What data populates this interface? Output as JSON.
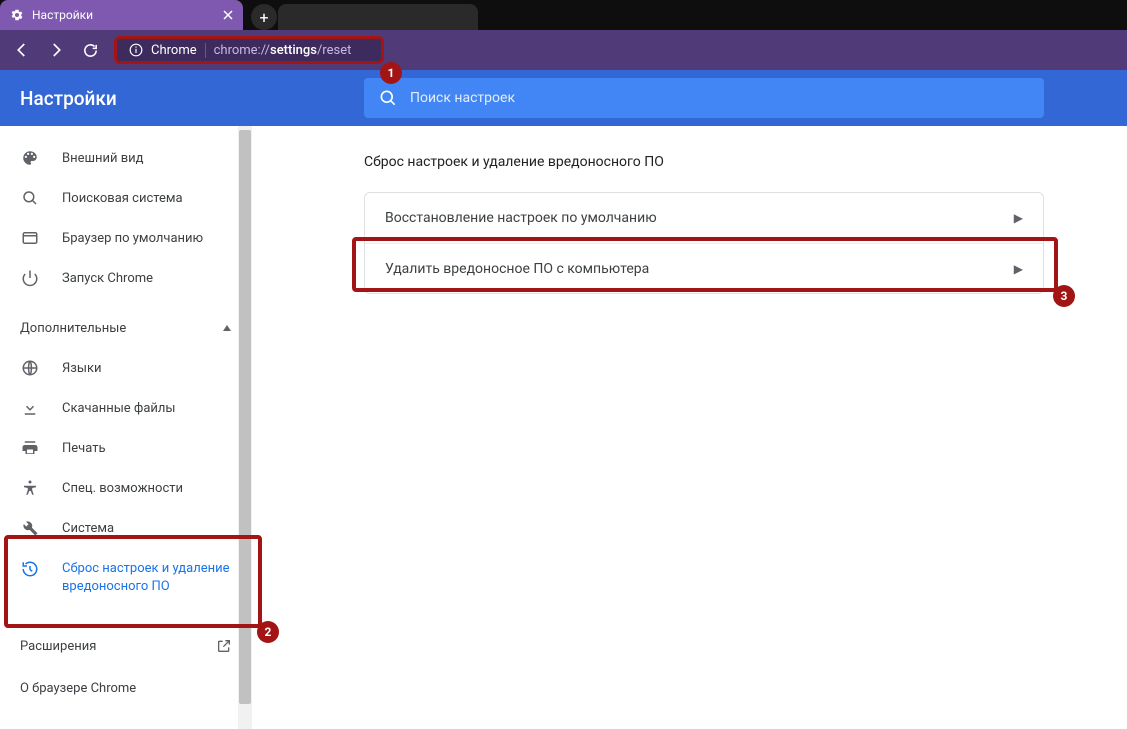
{
  "tabstrip": {
    "active_tab": "Настройки",
    "newtab_glyph": "+"
  },
  "omnibox": {
    "chip": "Chrome",
    "url_prefix": "chrome://",
    "url_bold": "settings",
    "url_suffix": "/reset"
  },
  "header": {
    "title": "Настройки",
    "search_placeholder": "Поиск настроек"
  },
  "sidebar": {
    "items_top": [
      {
        "label": "Внешний вид"
      },
      {
        "label": "Поисковая система"
      },
      {
        "label": "Браузер по умолчанию"
      },
      {
        "label": "Запуск Chrome"
      }
    ],
    "advanced_label": "Дополнительные",
    "items_adv": [
      {
        "label": "Языки"
      },
      {
        "label": "Скачанные файлы"
      },
      {
        "label": "Печать"
      },
      {
        "label": "Спец. возможности"
      },
      {
        "label": "Система"
      },
      {
        "label": "Сброс настроек и удаление вредоносного ПО"
      }
    ],
    "extensions": "Расширения",
    "about": "О браузере Chrome"
  },
  "main": {
    "section_title": "Сброс настроек и удаление вредоносного ПО",
    "rows": [
      "Восстановление настроек по умолчанию",
      "Удалить вредоносное ПО с компьютера"
    ]
  },
  "callouts": {
    "1": "1",
    "2": "2",
    "3": "3"
  }
}
